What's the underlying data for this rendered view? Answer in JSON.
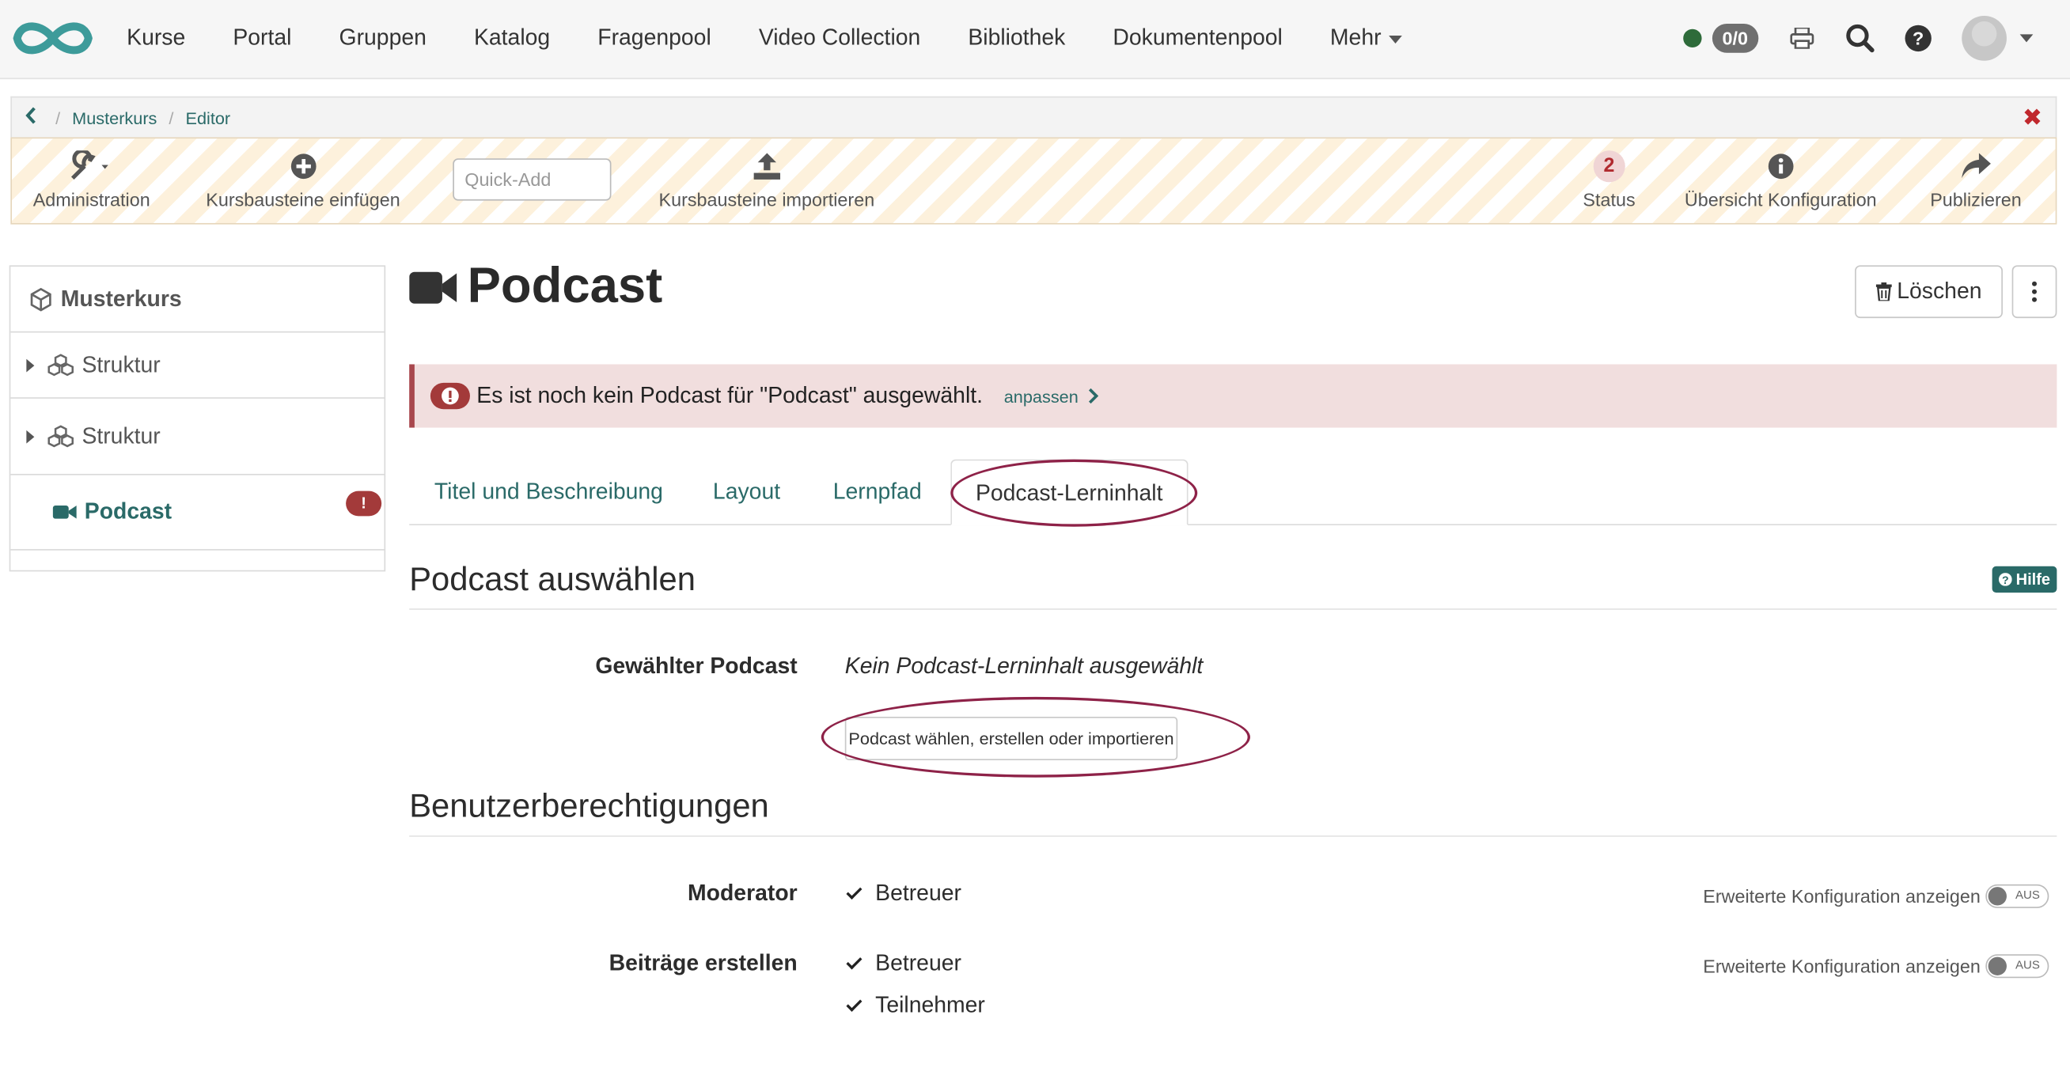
{
  "nav": {
    "items": [
      "Kurse",
      "Portal",
      "Gruppen",
      "Katalog",
      "Fragenpool",
      "Video Collection",
      "Bibliothek",
      "Dokumentenpool",
      "Mehr"
    ],
    "score": "0/0"
  },
  "breadcrumb": {
    "items": [
      "Musterkurs",
      "Editor"
    ]
  },
  "toolbar": {
    "administration": "Administration",
    "insert_elements": "Kursbausteine einfügen",
    "quick_add_placeholder": "Quick-Add",
    "import_elements": "Kursbausteine importieren",
    "status_label": "Status",
    "status_count": "2",
    "overview_config": "Übersicht Konfiguration",
    "publish": "Publizieren"
  },
  "sidemenu": {
    "root": "Musterkurs",
    "items": [
      {
        "label": "Struktur"
      },
      {
        "label": "Struktur"
      },
      {
        "label": "Podcast"
      }
    ]
  },
  "page": {
    "title": "Podcast",
    "delete_label": "Löschen"
  },
  "alert": {
    "text": "Es ist noch kein Podcast für \"Podcast\" ausgewählt.",
    "link": "anpassen"
  },
  "tabs": [
    "Titel und Beschreibung",
    "Layout",
    "Lernpfad",
    "Podcast-Lerninhalt"
  ],
  "select_section": {
    "title": "Podcast auswählen",
    "help": "Hilfe",
    "label": "Gewählter Podcast",
    "value": "Kein Podcast-Lerninhalt ausgewählt",
    "button": "Podcast wählen, erstellen oder importieren"
  },
  "permissions": {
    "title": "Benutzerberechtigungen",
    "moderator_label": "Moderator",
    "moderator_options": [
      "Betreuer"
    ],
    "create_label": "Beiträge erstellen",
    "create_options": [
      "Betreuer",
      "Teilnehmer"
    ],
    "advanced_label": "Erweiterte Konfiguration anzeigen",
    "toggle_label": "AUS"
  },
  "colors": {
    "accent": "#2a6a68",
    "error": "#a33a3a",
    "highlight": "#8e2248"
  }
}
